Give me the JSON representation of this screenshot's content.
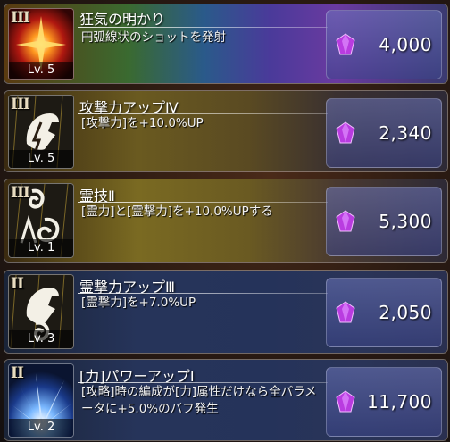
{
  "skills": [
    {
      "rank": "III",
      "name": "狂気の明かり",
      "desc": "円弧線状のショットを発射",
      "level": "Lv. 5",
      "cost": "4,000",
      "icon": "burst-icon"
    },
    {
      "rank": "III",
      "name": "攻撃力アップⅣ",
      "desc": "[攻撃力]を+10.0%UP",
      "level": "Lv. 5",
      "cost": "2,340",
      "icon": "attack-up-icon"
    },
    {
      "rank": "III",
      "name": "霊技Ⅱ",
      "desc": "[霊力]と[霊撃力]を+10.0%UPする",
      "level": "Lv. 1",
      "cost": "5,300",
      "icon": "spirit-tech-icon"
    },
    {
      "rank": "II",
      "name": "霊撃力アップⅢ",
      "desc": "[霊撃力]を+7.0%UP",
      "level": "Lv. 3",
      "cost": "2,050",
      "icon": "spirit-attack-up-icon"
    },
    {
      "rank": "II",
      "name": "[力]パワーアップⅠ",
      "desc": "[攻略]時の編成が[力]属性だけなら全パラメータに+5.0%のバフ発生",
      "level": "Lv. 2",
      "cost": "11,700",
      "icon": "power-burst-icon"
    }
  ],
  "colors": {
    "gem": "#b93ce0",
    "price_panel": "#5a64b0"
  }
}
